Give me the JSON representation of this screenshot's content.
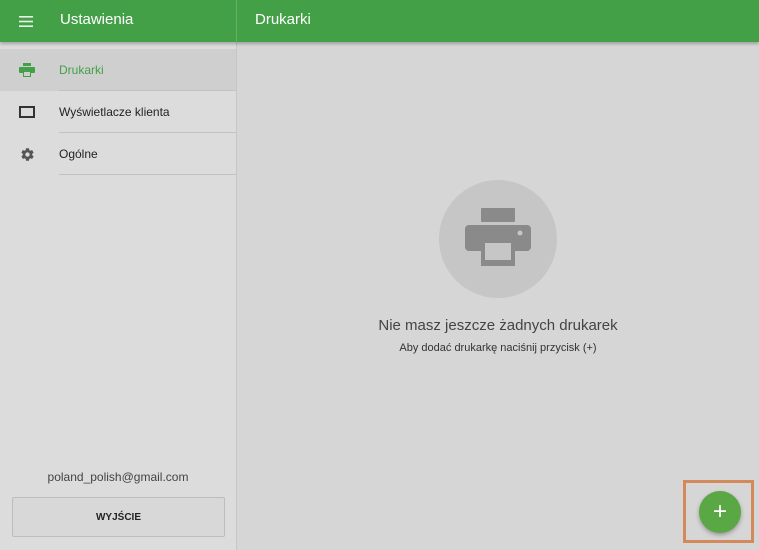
{
  "appbar": {
    "menu_icon": "hamburger-menu-icon",
    "left_title": "Ustawienia",
    "main_title": "Drukarki",
    "color": "#43a047"
  },
  "sidebar": {
    "items": [
      {
        "label": "Drukarki",
        "icon": "printer-icon",
        "active": true
      },
      {
        "label": "Wyświetlacze klienta",
        "icon": "monitor-icon",
        "active": false
      },
      {
        "label": "Ogólne",
        "icon": "gear-icon",
        "active": false
      }
    ],
    "account_email": "poland_polish@gmail.com",
    "exit_label": "WYJŚCIE"
  },
  "main": {
    "empty_icon": "printer-icon",
    "empty_title": "Nie masz jeszcze żadnych drukarek",
    "empty_subtitle": "Aby dodać drukarkę naciśnij przycisk (+)"
  },
  "fab": {
    "label": "+",
    "icon": "add-icon",
    "color": "#5aa845",
    "highlight_color": "#d4895a"
  }
}
